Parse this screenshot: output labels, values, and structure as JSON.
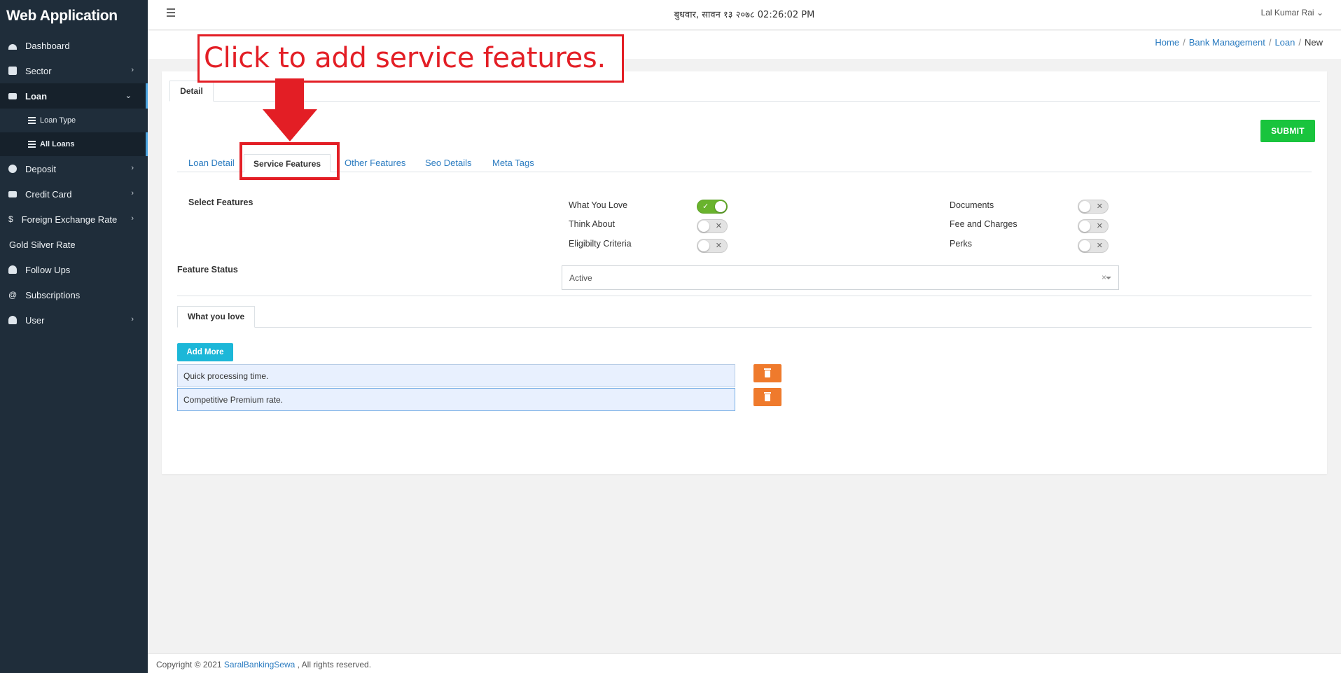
{
  "app": {
    "title": "Web Application"
  },
  "sidebar": {
    "items": [
      {
        "label": "Dashboard"
      },
      {
        "label": "Sector"
      },
      {
        "label": "Loan"
      },
      {
        "label": "Loan Type"
      },
      {
        "label": "All Loans"
      },
      {
        "label": "Deposit"
      },
      {
        "label": "Credit Card"
      },
      {
        "label": "Foreign Exchange Rate"
      },
      {
        "label": "Gold Silver Rate"
      },
      {
        "label": "Follow Ups"
      },
      {
        "label": "Subscriptions"
      },
      {
        "label": "User"
      }
    ],
    "dollar_glyph": "$",
    "at_glyph": "@"
  },
  "header": {
    "date": "बुधवार, सावन १३ २०७८  02:26:02 PM",
    "user": "Lal Kumar Rai"
  },
  "breadcrumb": {
    "home": "Home",
    "bank": "Bank Management",
    "loan": "Loan",
    "current": "New",
    "sep": "/"
  },
  "card": {
    "outer_tab": "Detail",
    "submit": "SUBMIT",
    "tabs": {
      "loan_detail": "Loan Detail",
      "service_features": "Service Features",
      "other_features": "Other Features",
      "seo_details": "Seo Details",
      "meta_tags": "Meta Tags"
    },
    "select_features_label": "Select Features",
    "features": {
      "what_you_love": {
        "label": "What You Love",
        "on": true
      },
      "think_about": {
        "label": "Think About",
        "on": false
      },
      "eligibility": {
        "label": "Eligibilty Criteria",
        "on": false
      },
      "documents": {
        "label": "Documents",
        "on": false
      },
      "fees": {
        "label": "Fee and Charges",
        "on": false
      },
      "perks": {
        "label": "Perks",
        "on": false
      }
    },
    "feature_status_label": "Feature Status",
    "feature_status_value": "Active",
    "wyl_tab": "What you love",
    "add_more": "Add More",
    "items": [
      "Quick processing time.",
      "Competitive Premium rate."
    ]
  },
  "annotation": {
    "text": "Click to add service features.",
    "color": "#e31e25"
  },
  "footer": {
    "copyright": "Copyright © 2021 ",
    "brand": "SaralBankingSewa",
    "rights": " , All rights reserved."
  },
  "colors": {
    "sidebar_bg": "#1f2d3a",
    "link": "#2a7bc0",
    "submit": "#19c43d",
    "add_more": "#1cb7d8",
    "delete": "#ef7a2c",
    "toggle_on": "#69b32d"
  },
  "icons": {
    "dashboard": "dashboard-icon",
    "sector": "sector-icon",
    "loan": "credit-card-icon",
    "list": "list-icon",
    "deposit": "piggy-bank-icon",
    "credit_card": "credit-card-icon",
    "fx": "dollar-icon",
    "follow_ups": "user-plus-icon",
    "subscriptions": "at-icon",
    "user": "users-icon",
    "trash": "trash-icon",
    "chevron_right": "chevron-right-icon",
    "chevron_down": "chevron-down-icon",
    "menu": "hamburger-icon"
  }
}
